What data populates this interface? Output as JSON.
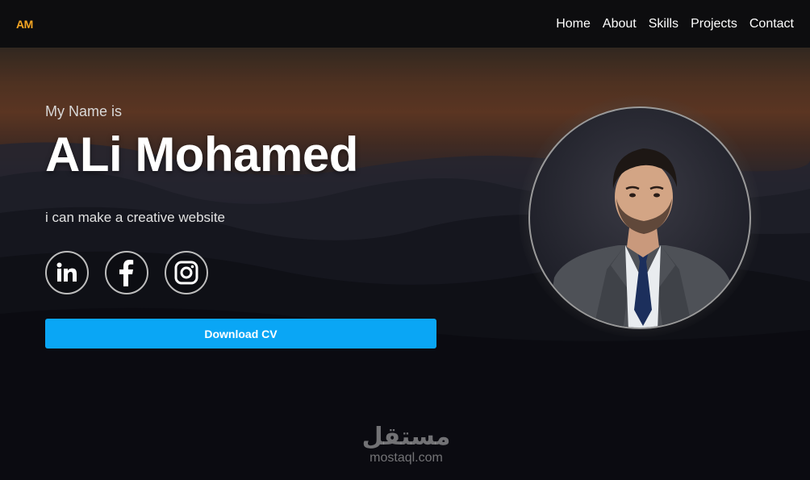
{
  "nav": {
    "logo": "AM",
    "links": [
      "Home",
      "About",
      "Skills",
      "Projects",
      "Contact"
    ]
  },
  "hero": {
    "intro": "My Name is",
    "name": "ALi Mohamed",
    "tagline": "i can make a creative website",
    "download_label": "Download CV",
    "socials": [
      {
        "icon": "linkedin-icon"
      },
      {
        "icon": "facebook-icon"
      },
      {
        "icon": "instagram-icon"
      }
    ]
  },
  "watermark": {
    "arabic": "مستقل",
    "latin": "mostaql.com"
  },
  "colors": {
    "accent": "#f5a623",
    "button": "#0aa6f5",
    "navbar": "#0d0d0f"
  }
}
